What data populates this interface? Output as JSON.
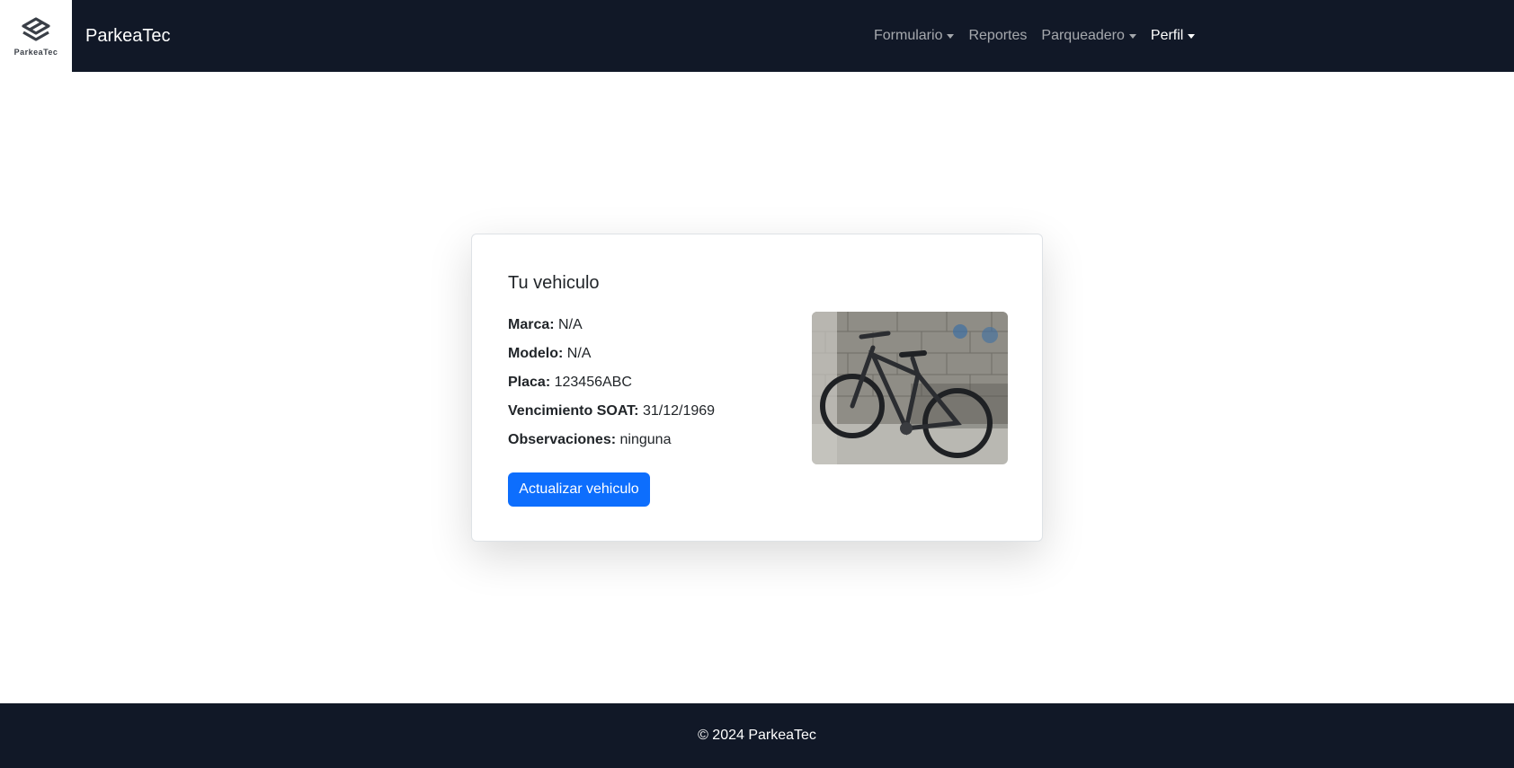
{
  "navbar": {
    "logo_text": "ParkeaTec",
    "brand": "ParkeaTec",
    "links": [
      {
        "label": "Formulario",
        "dropdown": true
      },
      {
        "label": "Reportes",
        "dropdown": false
      },
      {
        "label": "Parqueadero",
        "dropdown": true
      },
      {
        "label": "Perfil",
        "dropdown": true
      }
    ]
  },
  "vehicle": {
    "title": "Tu vehiculo",
    "fields": [
      {
        "label": "Marca:",
        "value": "N/A"
      },
      {
        "label": "Modelo:",
        "value": "N/A"
      },
      {
        "label": "Placa:",
        "value": "123456ABC"
      },
      {
        "label": "Vencimiento SOAT:",
        "value": "31/12/1969"
      },
      {
        "label": "Observaciones:",
        "value": "ninguna"
      }
    ],
    "update_button": "Actualizar vehiculo",
    "photo_icon": "bicycle-photo"
  },
  "footer": {
    "copyright": "© 2024 ParkeaTec"
  },
  "colors": {
    "navbar_bg": "#111827",
    "primary": "#0d6efd"
  }
}
